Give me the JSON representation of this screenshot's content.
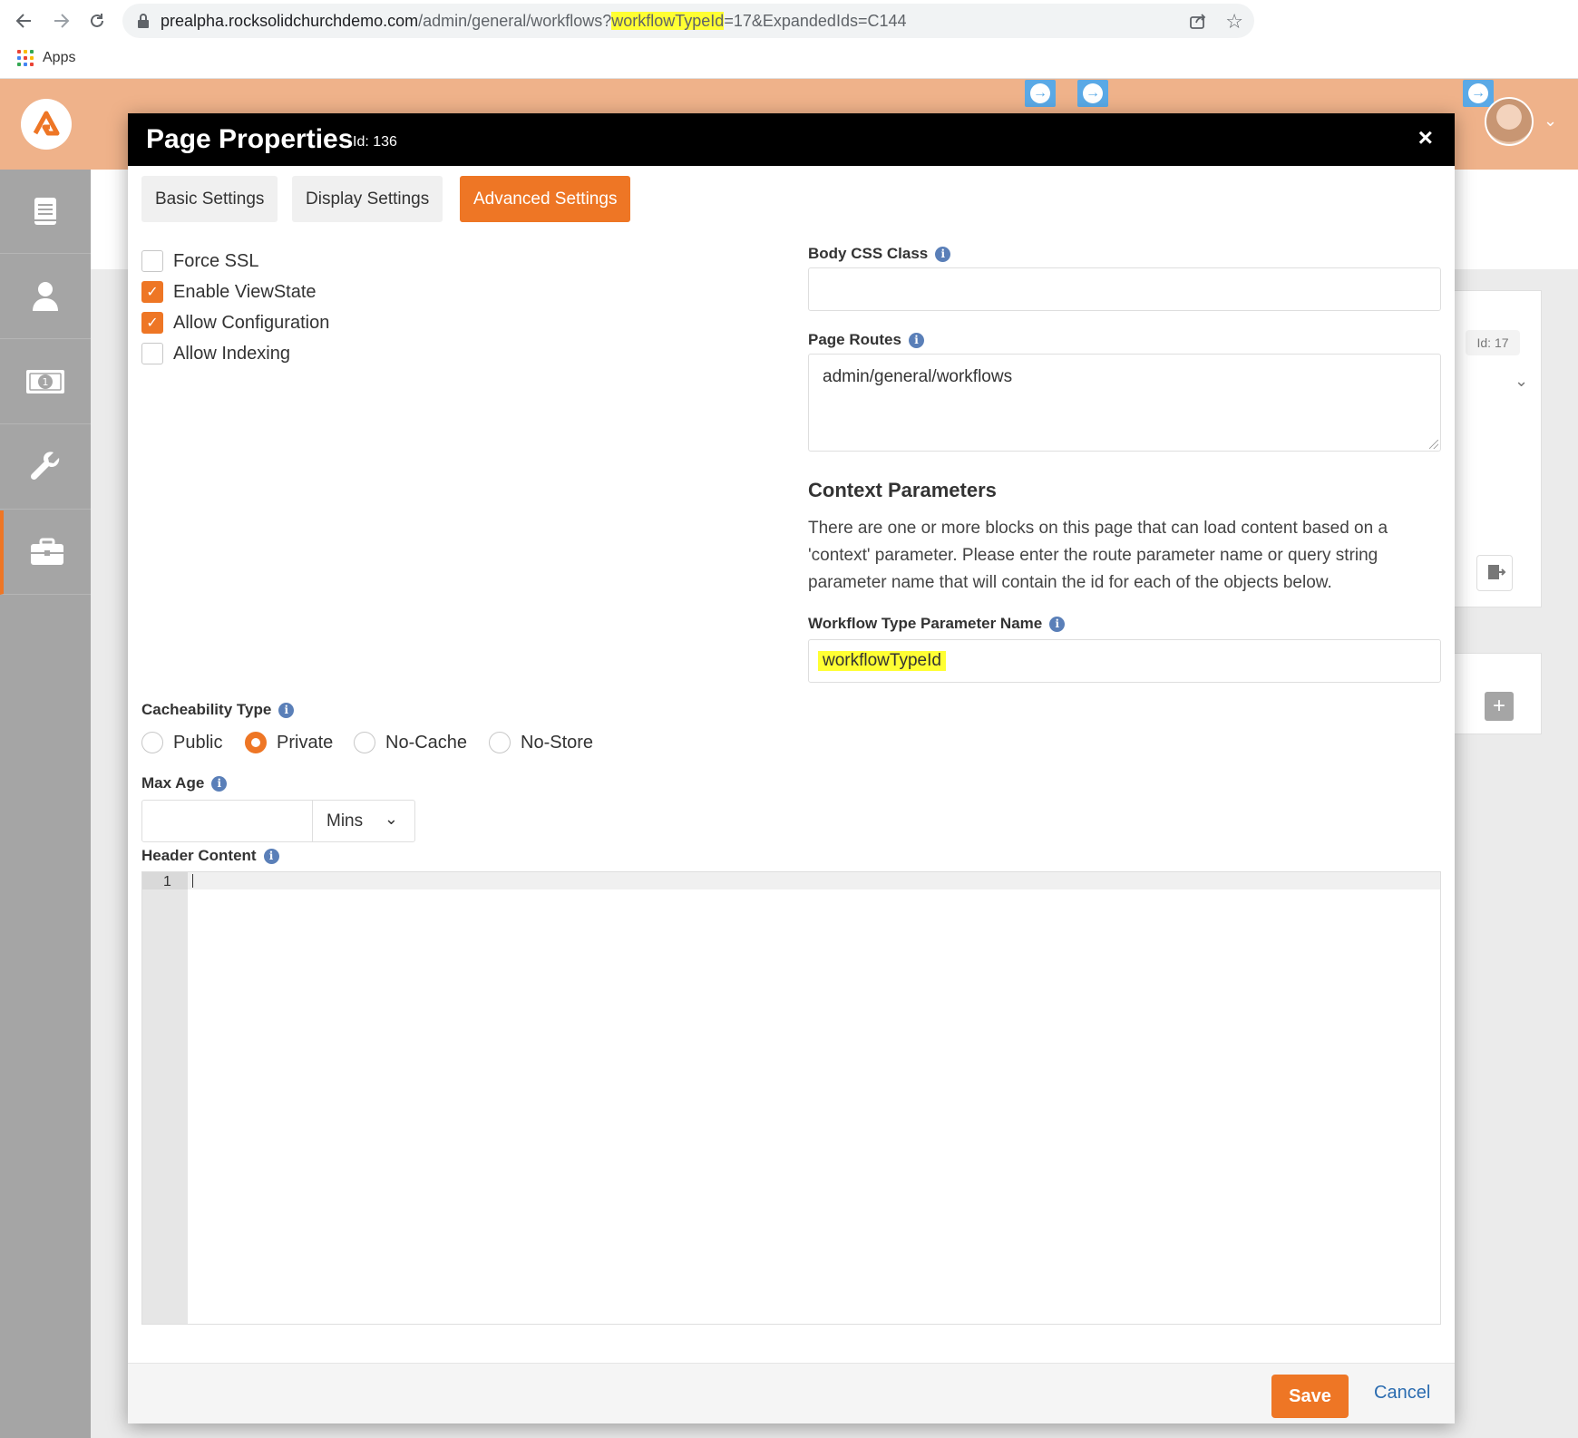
{
  "browser": {
    "url_host": "prealpha.rocksolidchurchdemo.com",
    "url_path_before": "/admin/general/workflows?",
    "url_highlight": "workflowTypeId",
    "url_path_after": "=17&ExpandedIds=C144",
    "bookmarks": {
      "apps_label": "Apps"
    }
  },
  "background": {
    "card_id": "Id: 17"
  },
  "modal": {
    "title": "Page Properties",
    "id_label": "Id: 136",
    "close_symbol": "×",
    "tabs": [
      {
        "label": "Basic Settings",
        "active": false
      },
      {
        "label": "Display Settings",
        "active": false
      },
      {
        "label": "Advanced Settings",
        "active": true
      }
    ],
    "checkboxes": [
      {
        "label": "Force SSL",
        "checked": false
      },
      {
        "label": "Enable ViewState",
        "checked": true
      },
      {
        "label": "Allow Configuration",
        "checked": true
      },
      {
        "label": "Allow Indexing",
        "checked": false
      }
    ],
    "body_css_class": {
      "label": "Body CSS Class",
      "value": ""
    },
    "page_routes": {
      "label": "Page Routes",
      "value": "admin/general/workflows"
    },
    "context": {
      "title": "Context Parameters",
      "help_line1": "There are one or more blocks on this page that can load content based on a",
      "help_line2": "'context' parameter. Please enter the route parameter name or query string",
      "help_line3": "parameter name that will contain the id for each of the objects below.",
      "workflow_param_label": "Workflow Type Parameter Name",
      "workflow_param_value": "workflowTypeId"
    },
    "cacheability": {
      "label": "Cacheability Type",
      "options": [
        {
          "label": "Public",
          "selected": false
        },
        {
          "label": "Private",
          "selected": true
        },
        {
          "label": "No-Cache",
          "selected": false
        },
        {
          "label": "No-Store",
          "selected": false
        }
      ]
    },
    "max_age": {
      "label": "Max Age",
      "value": "",
      "unit": "Mins"
    },
    "header_content": {
      "label": "Header Content",
      "line_number": "1"
    },
    "footer": {
      "save_label": "Save",
      "cancel_label": "Cancel"
    }
  },
  "colors": {
    "accent": "#ee7625",
    "header_bg": "#efb28a",
    "sidebar_bg": "#a5a5a5",
    "info_icon": "#5a7fb8",
    "highlight": "#ffff33",
    "link": "#2b6cb0"
  }
}
